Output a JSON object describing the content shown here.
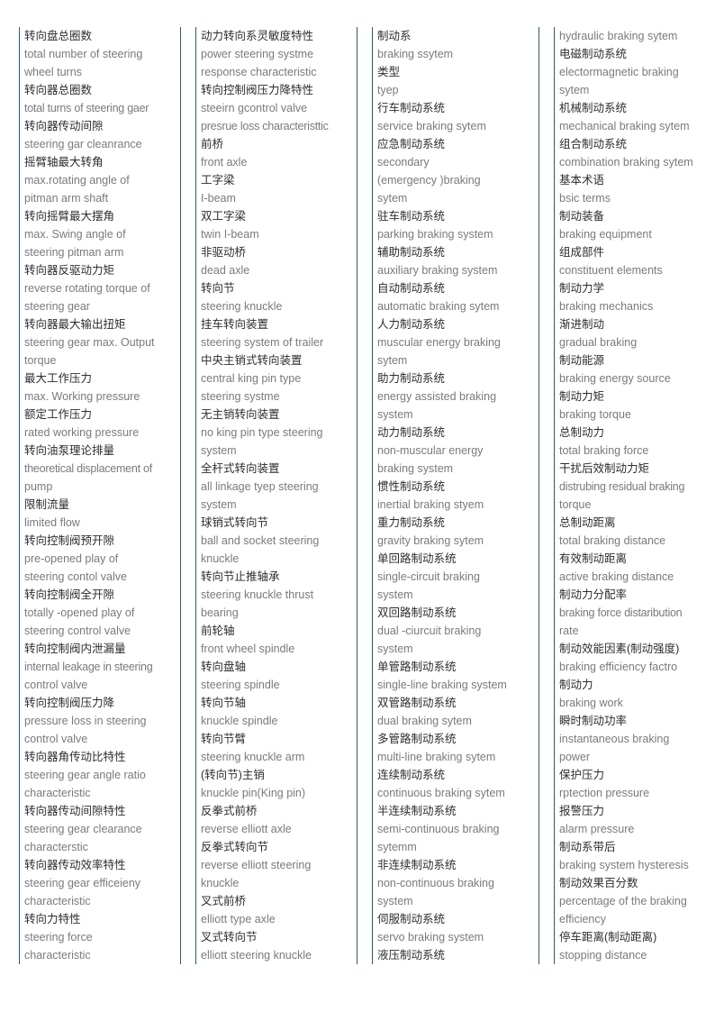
{
  "page": {
    "title": "Automotive Terminology Glossary",
    "layout": "four-column bilingual term list",
    "text_color_chinese": "#2d2d2d",
    "text_color_english": "#7a7a7a",
    "column_border_color": "#31576e"
  },
  "columns": [
    {
      "id": "column-1",
      "entries": [
        {
          "zh": "转向盘总圈数",
          "en": [
            "total number of steering",
            "wheel turns"
          ]
        },
        {
          "zh": "转向器总圈数",
          "en": [
            "total turns of steering gaer"
          ]
        },
        {
          "zh": "转向器传动间隙",
          "en": [
            "steering gar cleanrance"
          ]
        },
        {
          "zh": "摇臂轴最大转角",
          "en": [
            "max.rotating angle of",
            "pitman arm shaft"
          ]
        },
        {
          "zh": "转向摇臂最大摆角",
          "en": [
            "max. Swing angle of",
            "steering pitman arm"
          ]
        },
        {
          "zh": "转向器反驱动力矩",
          "en": [
            "reverse rotating torque of",
            "steering gear"
          ]
        },
        {
          "zh": "转向器最大输出扭矩",
          "en": [
            "steering gear max. Output",
            "torque"
          ]
        },
        {
          "zh": "最大工作压力",
          "en": [
            "max. Working pressure"
          ]
        },
        {
          "zh": "额定工作压力",
          "en": [
            "rated working pressure"
          ]
        },
        {
          "zh": "转向油泵理论排量",
          "en": [
            "theoretical displacement of",
            "pump"
          ]
        },
        {
          "zh": "限制流量",
          "en": [
            "limited flow"
          ]
        },
        {
          "zh": "转向控制阀预开隙",
          "en": [
            "pre-opened play of",
            "steering contol valve"
          ]
        },
        {
          "zh": "转向控制阀全开隙",
          "en": [
            "totally -opened play of",
            "steering control valve"
          ]
        },
        {
          "zh": "转向控制阀内泄漏量",
          "en": [
            "internal leakage in steering",
            "control valve"
          ]
        },
        {
          "zh": "转向控制阀压力降",
          "en": [
            "pressure loss in steering",
            "control valve"
          ]
        },
        {
          "zh": "转向器角传动比特性",
          "en": [
            "steering gear angle ratio",
            "characteristic"
          ]
        },
        {
          "zh": "转向器传动间隙特性",
          "en": [
            "steering gear clearance",
            "characterstic"
          ]
        },
        {
          "zh": "转向器传动效率特性",
          "en": [
            "steering gear efficeieny",
            "characteristic"
          ]
        },
        {
          "zh": "转向力特性",
          "en": [
            "steering force",
            "characteristic"
          ]
        }
      ]
    },
    {
      "id": "column-2",
      "entries": [
        {
          "zh": "动力转向系灵敏度特性",
          "en": [
            "power steering systme",
            "response characteristic"
          ]
        },
        {
          "zh": "转向控制阀压力降特性",
          "en": [
            "steeirn gcontrol valve",
            "presrue loss characteristtic"
          ]
        },
        {
          "zh": "前桥",
          "en": [
            "front axle"
          ]
        },
        {
          "zh": "工字梁",
          "en": [
            "I-beam"
          ]
        },
        {
          "zh": "双工字梁",
          "en": [
            "twin I-beam"
          ]
        },
        {
          "zh": "非驱动桥",
          "en": [
            "dead axle"
          ]
        },
        {
          "zh": "转向节",
          "en": [
            "steering knuckle"
          ]
        },
        {
          "zh": "挂车转向装置",
          "en": [
            "steering system of trailer"
          ]
        },
        {
          "zh": "中央主销式转向装置",
          "en": [
            "central king pin type",
            "steering systme"
          ]
        },
        {
          "zh": "无主销转向装置",
          "en": [
            "no king pin type steering",
            "system"
          ]
        },
        {
          "zh": "全杆式转向装置",
          "en": [
            "all linkage tyep steering",
            "system"
          ]
        },
        {
          "zh": "球销式转向节",
          "en": [
            "ball and socket steering",
            "knuckle"
          ]
        },
        {
          "zh": "转向节止推轴承",
          "en": [
            "steering knuckle thrust",
            "bearing"
          ]
        },
        {
          "zh": "前轮轴",
          "en": [
            "front wheel spindle"
          ]
        },
        {
          "zh": "转向盘轴",
          "en": [
            "steering spindle"
          ]
        },
        {
          "zh": "转向节轴",
          "en": [
            "knuckle spindle"
          ]
        },
        {
          "zh": "转向节臂",
          "en": [
            "steering knuckle arm"
          ]
        },
        {
          "zh": "(转向节)主销",
          "en": [
            "knuckle pin(King pin)"
          ]
        },
        {
          "zh": "反拳式前桥",
          "en": [
            "reverse elliott axle"
          ]
        },
        {
          "zh": "反拳式转向节",
          "en": [
            "reverse elliott steering",
            "knuckle"
          ]
        },
        {
          "zh": "叉式前桥",
          "en": [
            "elliott type axle"
          ]
        },
        {
          "zh": "叉式转向节",
          "en": [
            "elliott steering knuckle"
          ]
        }
      ]
    },
    {
      "id": "column-3",
      "entries": [
        {
          "zh": "制动系",
          "en": [
            "braking ssytem"
          ]
        },
        {
          "zh": "类型",
          "en": [
            "tyep"
          ]
        },
        {
          "zh": "行车制动系统",
          "en": [
            "service braking sytem"
          ]
        },
        {
          "zh": "应急制动系统",
          "en": [
            "secondary",
            "(emergency )braking",
            "sytem"
          ]
        },
        {
          "zh": "驻车制动系统",
          "en": [
            "parking braking system"
          ]
        },
        {
          "zh": "辅助制动系统",
          "en": [
            "auxiliary braking system"
          ]
        },
        {
          "zh": "自动制动系统",
          "en": [
            "automatic braking sytem"
          ]
        },
        {
          "zh": "人力制动系统",
          "en": [
            "muscular energy braking",
            "sytem"
          ]
        },
        {
          "zh": "助力制动系统",
          "en": [
            "energy assisted braking",
            "system"
          ]
        },
        {
          "zh": "动力制动系统",
          "en": [
            "non-muscular energy",
            "braking system"
          ]
        },
        {
          "zh": "惯性制动系统",
          "en": [
            "inertial braking styem"
          ]
        },
        {
          "zh": "重力制动系统",
          "en": [
            "gravity braking sytem"
          ]
        },
        {
          "zh": "单回路制动系统",
          "en": [
            "single-circuit braking",
            "system"
          ]
        },
        {
          "zh": "双回路制动系统",
          "en": [
            "dual -ciurcuit braking",
            "system"
          ]
        },
        {
          "zh": "单管路制动系统",
          "en": [
            "single-line braking system"
          ]
        },
        {
          "zh": "双管路制动系统",
          "en": [
            "dual braking sytem"
          ]
        },
        {
          "zh": "多管路制动系统",
          "en": [
            "multi-line braking sytem"
          ]
        },
        {
          "zh": "连续制动系统",
          "en": [
            "continuous braking sytem"
          ]
        },
        {
          "zh": "半连续制动系统",
          "en": [
            "semi-continuous braking",
            "sytemm"
          ]
        },
        {
          "zh": "非连续制动系统",
          "en": [
            "non-continuous braking",
            "system"
          ]
        },
        {
          "zh": "伺服制动系统",
          "en": [
            "servo braking system"
          ]
        },
        {
          "zh": "液压制动系统",
          "en": []
        }
      ]
    },
    {
      "id": "column-4",
      "entries": [
        {
          "zh": "",
          "en": [
            "hydraulic braking sytem"
          ]
        },
        {
          "zh": "电磁制动系统",
          "en": [
            "electormagnetic braking",
            "sytem"
          ]
        },
        {
          "zh": "机械制动系统",
          "en": [
            "mechanical braking sytem"
          ]
        },
        {
          "zh": "组合制动系统",
          "en": [
            "combination braking sytem"
          ]
        },
        {
          "zh": "基本术语",
          "en": [
            "bsic terms"
          ]
        },
        {
          "zh": "制动装备",
          "en": [
            "braking equipment"
          ]
        },
        {
          "zh": "组成部件",
          "en": [
            "constituent elements"
          ]
        },
        {
          "zh": "制动力学",
          "en": [
            "braking mechanics"
          ]
        },
        {
          "zh": "渐进制动",
          "en": [
            "gradual braking"
          ]
        },
        {
          "zh": "制动能源",
          "en": [
            "braking energy source"
          ]
        },
        {
          "zh": "制动力矩",
          "en": [
            "braking torque"
          ]
        },
        {
          "zh": "总制动力",
          "en": [
            "total braking force"
          ]
        },
        {
          "zh": "干扰后效制动力矩",
          "en": [
            "distrubing residual braking",
            "torque"
          ]
        },
        {
          "zh": "总制动距离",
          "en": [
            "total braking distance"
          ]
        },
        {
          "zh": "有效制动距离",
          "en": [
            "active braking distance"
          ]
        },
        {
          "zh": "制动力分配率",
          "en": [
            "braking force distaribution",
            "rate"
          ]
        },
        {
          "zh": "制动效能因素(制动强度)",
          "en": [
            "braking efficiency factro"
          ]
        },
        {
          "zh": "制动力",
          "en": [
            "braking work"
          ]
        },
        {
          "zh": "瞬时制动功率",
          "en": [
            "instantaneous braking",
            "power"
          ]
        },
        {
          "zh": "保护压力",
          "en": [
            "rptection pressure"
          ]
        },
        {
          "zh": "报警压力",
          "en": [
            "alarm pressure"
          ]
        },
        {
          "zh": "制动系带后",
          "en": [
            "braking system hysteresis"
          ]
        },
        {
          "zh": "制动效果百分数",
          "en": [
            "percentage of the braking",
            "efficiency"
          ]
        },
        {
          "zh": "停车距离(制动距离)",
          "en": [
            "stopping distance"
          ]
        }
      ]
    }
  ]
}
